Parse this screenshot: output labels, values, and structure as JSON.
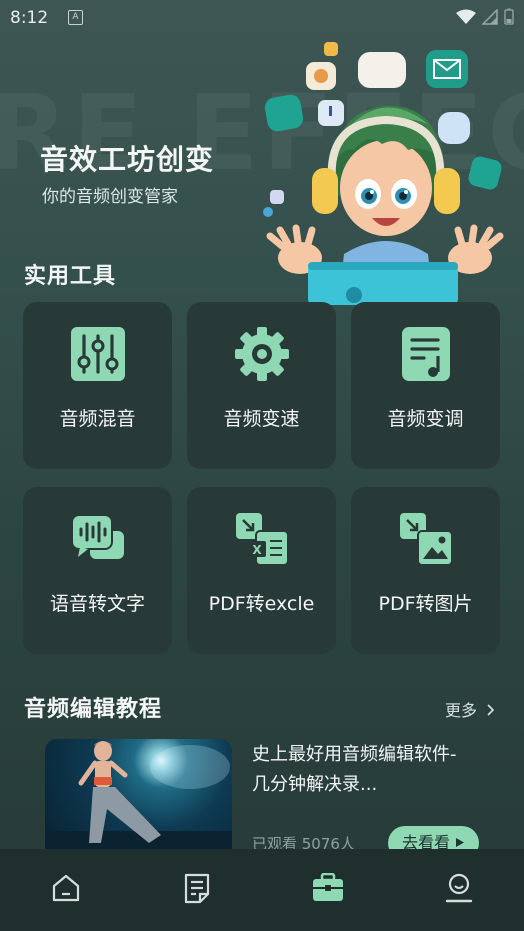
{
  "status": {
    "time": "8:12",
    "a_icon": "A"
  },
  "watermark": "RE EFFECT",
  "hero": {
    "title": "音效工坊创变",
    "subtitle": "你的音频创变管家"
  },
  "tools": {
    "section_title": "实用工具",
    "items": [
      {
        "label": "音频混音",
        "icon": "sliders-icon"
      },
      {
        "label": "音频变速",
        "icon": "gear-icon"
      },
      {
        "label": "音频变调",
        "icon": "music-note-icon"
      },
      {
        "label": "语音转文字",
        "icon": "speech-icon"
      },
      {
        "label": "PDF转excle",
        "icon": "pdf-excel-icon"
      },
      {
        "label": "PDF转图片",
        "icon": "pdf-image-icon"
      }
    ]
  },
  "tutorials": {
    "section_title": "音频编辑教程",
    "more_label": "更多",
    "video": {
      "title": "史上最好用音频编辑软件-几分钟解决录...",
      "views": "已观看 5076人",
      "button_label": "去看看"
    }
  },
  "colors": {
    "accent": "#8fd8b4",
    "card": "#283a37",
    "nav": "#1f2f2d"
  },
  "nav": [
    {
      "name": "home-icon"
    },
    {
      "name": "document-icon"
    },
    {
      "name": "toolbox-icon",
      "active": true
    },
    {
      "name": "profile-icon"
    }
  ]
}
